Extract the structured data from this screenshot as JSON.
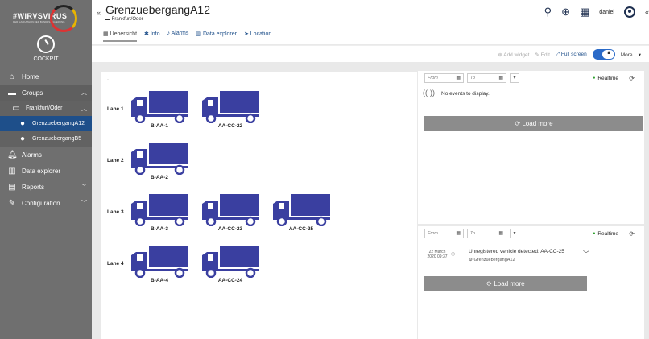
{
  "sidebar": {
    "logo_text": "#WIRVSVIRUS",
    "logo_sub": "DER HACKATHON DER BUNDESREGIERUNG",
    "cockpit_label": "COCKPIT",
    "items": [
      {
        "label": "Home",
        "icon": "home-icon"
      },
      {
        "label": "Groups",
        "icon": "folder-icon"
      },
      {
        "label": "Frankfurt/Oder",
        "icon": "folder-open-icon"
      },
      {
        "label": "GrenzuebergangA12",
        "icon": "device-icon"
      },
      {
        "label": "GrenzuebergangB5",
        "icon": "device-icon"
      },
      {
        "label": "Alarms",
        "icon": "bell-icon"
      },
      {
        "label": "Data explorer",
        "icon": "chart-icon"
      },
      {
        "label": "Reports",
        "icon": "report-icon"
      },
      {
        "label": "Configuration",
        "icon": "wrench-icon"
      }
    ]
  },
  "header": {
    "title": "GrenzuebergangA12",
    "subtitle": "Frankfurt/Oder",
    "user": "daniel",
    "tabs": [
      {
        "label": "Uebersicht"
      },
      {
        "label": "Info"
      },
      {
        "label": "Alarms"
      },
      {
        "label": "Data explorer"
      },
      {
        "label": "Location"
      }
    ]
  },
  "toolbar": {
    "add_widget": "Add widget",
    "edit": "Edit",
    "full_screen": "Full screen",
    "more": "More..."
  },
  "lanes": [
    {
      "label": "Lane 1",
      "trucks": [
        "B-AA-1",
        "AA-CC-22"
      ]
    },
    {
      "label": "Lane 2",
      "trucks": [
        "B-AA-2"
      ]
    },
    {
      "label": "Lane 3",
      "trucks": [
        "B-AA-3",
        "AA-CC-23",
        "AA-CC-25"
      ]
    },
    {
      "label": "Lane 4",
      "trucks": [
        "B-AA-4",
        "AA-CC-24"
      ]
    }
  ],
  "events_widget": {
    "from_placeholder": "From",
    "to_placeholder": "To",
    "realtime": "Realtime",
    "empty": "No events to display.",
    "load_more": "Load more"
  },
  "alarms_widget": {
    "from_placeholder": "From",
    "to_placeholder": "To",
    "realtime": "Realtime",
    "load_more": "Load more",
    "event": {
      "date": "22 March",
      "time": "2020 09:37",
      "title": "Unregistered vehicle detected: AA-CC-25",
      "source": "GrenzuebergangA12"
    }
  },
  "colors": {
    "sidebar": "#6f6f6f",
    "active": "#1e4f8a",
    "truck": "#3a3fa0",
    "realtime_dot": "#2ca02c"
  }
}
